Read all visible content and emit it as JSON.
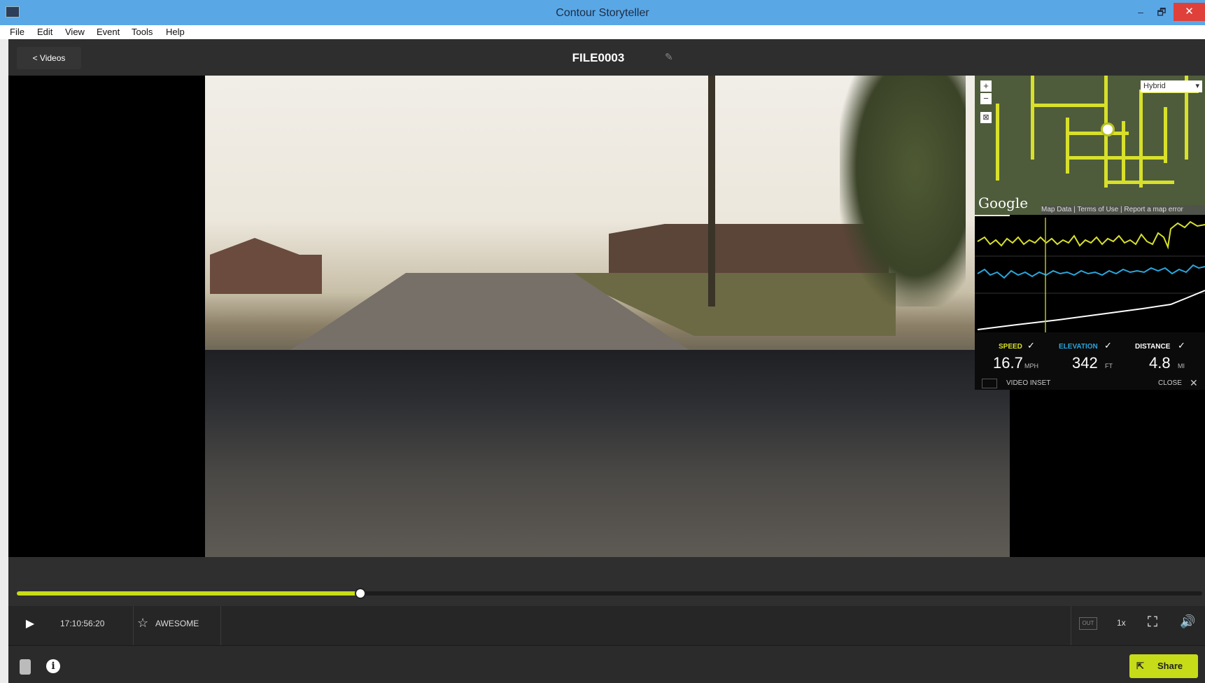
{
  "window": {
    "title": "Contour Storyteller",
    "minimize": "–",
    "restore": "🗗",
    "close": "✕"
  },
  "menu": [
    "File",
    "Edit",
    "View",
    "Event",
    "Tools",
    "Help"
  ],
  "header": {
    "back_label": "< Videos",
    "file_title": "FILE0003",
    "edit_icon": "pencil-icon"
  },
  "map": {
    "type_label": "Hybrid",
    "zoom_in": "+",
    "zoom_out": "−",
    "google_label": "Google",
    "links": [
      "Map Data",
      "Terms of Use",
      "Report a map error"
    ]
  },
  "stats": {
    "speed": {
      "label": "SPEED",
      "value": "16.7",
      "unit": "MPH",
      "color": "#d8e02a"
    },
    "elevation": {
      "label": "ELEVATION",
      "value": "342",
      "unit": "FT",
      "color": "#2aa6dc"
    },
    "distance": {
      "label": "DISTANCE",
      "value": "4.8",
      "unit": "MI",
      "color": "#ffffff"
    },
    "video_inset_label": "VIDEO INSET",
    "close_label": "CLOSE"
  },
  "playback": {
    "progress": 0.29,
    "timecode": "17:10:56:20",
    "awesome_label": "AWESOME",
    "speed_label": "1x",
    "inset_icon_label": "OUT"
  },
  "footer": {
    "share_label": "Share"
  },
  "colors": {
    "accent": "#c7dc16",
    "titlebar": "#5aa7e6",
    "close": "#e0403a"
  }
}
